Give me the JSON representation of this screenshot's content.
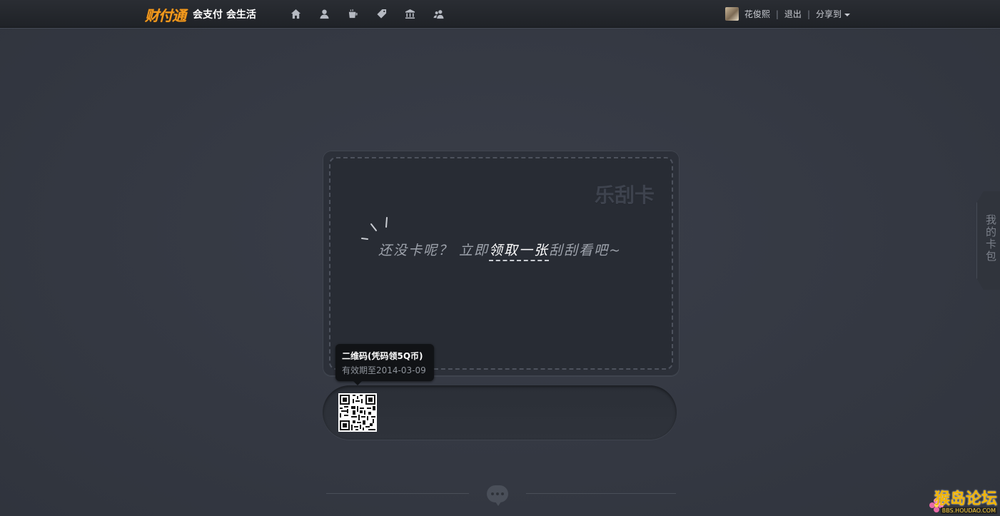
{
  "topbar": {
    "logo_text": "财付通",
    "slogan": "会支付 会生活",
    "nav_icons": [
      "home-icon",
      "user-icon",
      "cup-icon",
      "tag-icon",
      "bank-icon",
      "friends-icon"
    ],
    "user_name": "花俊熙",
    "logout": "退出",
    "share": "分享到",
    "separator": "|"
  },
  "card": {
    "title": "乐刮卡",
    "prompt_prefix": "还没卡呢？ 立即",
    "prompt_link": "领取一张",
    "prompt_suffix": "刮刮看吧~"
  },
  "tooltip": {
    "title": "二维码(凭码领5Q币)",
    "subtitle": "有效期至2014-03-09"
  },
  "sidetab": {
    "label": "我的卡包"
  },
  "watermark": {
    "main": "猴岛论坛",
    "sub": "BBS.HOUDAO.COM"
  },
  "colors": {
    "background": "#353943",
    "logo_orange": "#f29a1e",
    "link_white": "#ffffff"
  }
}
